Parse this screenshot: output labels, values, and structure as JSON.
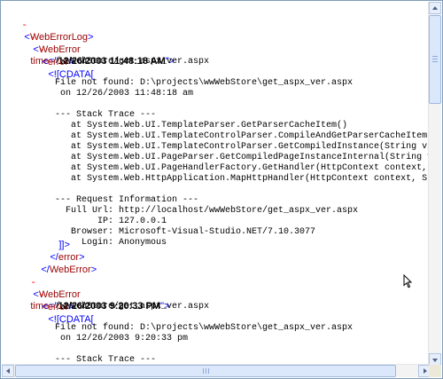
{
  "collapse_marker": "-",
  "root_tag": "WebErrorLog",
  "weberror_tag": "WebError",
  "error_tag": "error",
  "attr_name": "time",
  "cdata_open": "<![CDATA[",
  "cdata_close": "]]>",
  "entries": [
    {
      "time": "12/26/2003 11:48:18 AM",
      "lines": [
        "/wwWebStore/get_aspx_ver.aspx",
        "",
        "File not found: D:\\projects\\wwWebStore\\get_aspx_ver.aspx",
        " on 12/26/2003 11:48:18 am",
        "",
        "--- Stack Trace ---",
        "   at System.Web.UI.TemplateParser.GetParserCacheItem()",
        "   at System.Web.UI.TemplateControlParser.CompileAndGetParserCacheItem(String",
        "   at System.Web.UI.TemplateControlParser.GetCompiledInstance(String virtualP",
        "   at System.Web.UI.PageParser.GetCompiledPageInstanceInternal(String virtual",
        "   at System.Web.UI.PageHandlerFactory.GetHandler(HttpContext context, String",
        "   at System.Web.HttpApplication.MapHttpHandler(HttpContext context, String r",
        "",
        "--- Request Information ---",
        "  Full Url: http://localhost/wwWebStore/get_aspx_ver.aspx",
        "        IP: 127.0.0.1",
        "   Browser: Microsoft-Visual-Studio.NET/7.10.3077",
        "     Login: Anonymous"
      ]
    },
    {
      "time": "12/26/2003 9:20:33 PM",
      "lines": [
        "/wwWebStore/get_aspx_ver.aspx",
        "",
        "File not found: D:\\projects\\wwWebStore\\get_aspx_ver.aspx",
        " on 12/26/2003 9:20:33 pm",
        "",
        "--- Stack Trace ---",
        "   at System.Web.UI.TemplateParser.GetParserCacheItem()",
        "   at System.Web.UI.TemplateControlParser.CompileAndGetParserCacheItem(String"
      ]
    }
  ]
}
